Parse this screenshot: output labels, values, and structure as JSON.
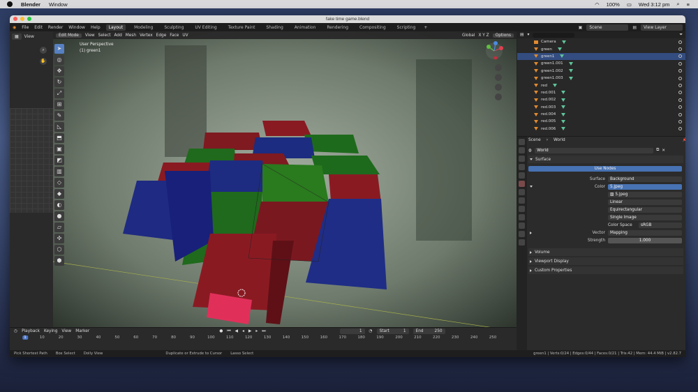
{
  "mac": {
    "app": "Blender",
    "menu_window": "Window",
    "battery": "100%",
    "clock": "Wed 3:12 pm"
  },
  "window": {
    "title": "fake time game.blend"
  },
  "topbar": {
    "menus": [
      "File",
      "Edit",
      "Render",
      "Window",
      "Help"
    ],
    "workspaces": [
      "Layout",
      "Modeling",
      "Sculpting",
      "UV Editing",
      "Texture Paint",
      "Shading",
      "Animation",
      "Rendering",
      "Compositing",
      "Scripting"
    ],
    "active_workspace": "Layout",
    "scene": "Scene",
    "view_layer": "View Layer"
  },
  "left_panel": {
    "view_label": "View"
  },
  "viewport": {
    "mode": "Edit Mode",
    "menus": [
      "View",
      "Select",
      "Add",
      "Mesh",
      "Vertex",
      "Edge",
      "Face",
      "UV"
    ],
    "transform_space": "Global",
    "axes": "X  Y  Z",
    "options": "Options",
    "info_line1": "User Perspective",
    "info_line2": "(1) green1"
  },
  "outliner": {
    "rows": [
      {
        "name": "Camera",
        "kind": "camera",
        "selected": false
      },
      {
        "name": "green",
        "kind": "mesh",
        "selected": false
      },
      {
        "name": "green1",
        "kind": "mesh",
        "selected": true
      },
      {
        "name": "green1.001",
        "kind": "mesh",
        "selected": false
      },
      {
        "name": "green1.002",
        "kind": "mesh",
        "selected": false
      },
      {
        "name": "green1.003",
        "kind": "mesh",
        "selected": false
      },
      {
        "name": "red",
        "kind": "mesh",
        "selected": false
      },
      {
        "name": "red.001",
        "kind": "mesh",
        "selected": false
      },
      {
        "name": "red.002",
        "kind": "mesh",
        "selected": false
      },
      {
        "name": "red.003",
        "kind": "mesh",
        "selected": false
      },
      {
        "name": "red.004",
        "kind": "mesh",
        "selected": false
      },
      {
        "name": "red.005",
        "kind": "mesh",
        "selected": false
      },
      {
        "name": "red.006",
        "kind": "mesh",
        "selected": false
      }
    ]
  },
  "properties": {
    "breadcrumb_scene": "Scene",
    "breadcrumb_world": "World",
    "world_name": "World",
    "surface_label": "Surface",
    "use_nodes": "Use Nodes",
    "surface_field_label": "Surface",
    "surface_value": "Background",
    "color_label": "Color",
    "color_value": "5.jpeg",
    "image_name": "5.jpeg",
    "interpolation": "Linear",
    "projection": "Equirectangular",
    "source": "Single Image",
    "color_space_label": "Color Space",
    "color_space_value": "sRGB",
    "vector_label": "Vector",
    "vector_value": "Mapping",
    "strength_label": "Strength",
    "strength_value": "1.000",
    "panels": [
      "Volume",
      "Viewport Display",
      "Custom Properties"
    ]
  },
  "timeline": {
    "menus": [
      "Playback",
      "Keying",
      "View",
      "Marker"
    ],
    "current_frame": "1",
    "start_label": "Start",
    "start_value": "1",
    "end_label": "End",
    "end_value": "250",
    "ticks": [
      "1",
      "10",
      "20",
      "30",
      "40",
      "50",
      "60",
      "70",
      "80",
      "90",
      "100",
      "110",
      "120",
      "130",
      "140",
      "150",
      "160",
      "170",
      "180",
      "190",
      "200",
      "210",
      "220",
      "230",
      "240",
      "250"
    ]
  },
  "status": {
    "items": [
      "Pick Shortest Path",
      "Box Select",
      "Dolly View",
      "Duplicate or Extrude to Cursor",
      "Lasso Select"
    ],
    "stats": "green1 | Verts:0/24 | Edges:0/44 | Faces:0/21 | Tris:42 | Mem: 44.4 MiB | v2.82.7"
  },
  "colors": {
    "accent": "#4772b3",
    "cube_red": "#8a1a22",
    "cube_blue": "#1e2a7a",
    "cube_green": "#1f6a1c"
  }
}
